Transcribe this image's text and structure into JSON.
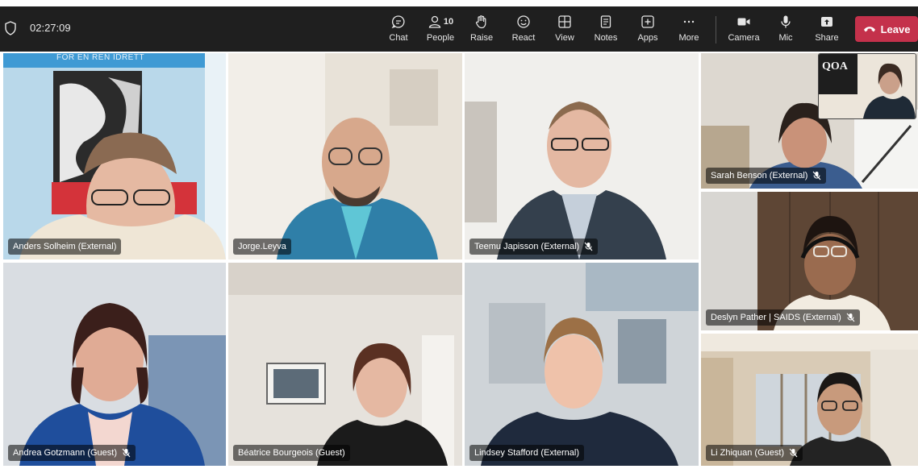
{
  "meeting": {
    "duration": "02:27:09"
  },
  "toolbar": {
    "chat": "Chat",
    "people": "People",
    "people_count": "10",
    "raise": "Raise",
    "react": "React",
    "view": "View",
    "notes": "Notes",
    "apps": "Apps",
    "more": "More",
    "camera": "Camera",
    "mic": "Mic",
    "share": "Share",
    "leave": "Leave"
  },
  "participants": [
    {
      "name": "Anders Solheim (External)",
      "muted": false
    },
    {
      "name": "Jorge.Leyva",
      "muted": false
    },
    {
      "name": "Teemu Japisson (External)",
      "muted": true
    },
    {
      "name": "Sarah Benson (External)",
      "muted": true
    },
    {
      "name": "Deslyn Pather | SAIDS (External)",
      "muted": true
    },
    {
      "name": "Andrea Gotzmann (Guest)",
      "muted": true
    },
    {
      "name": "Béatrice Bourgeois (Guest)",
      "muted": false
    },
    {
      "name": "Lindsey Stafford (External)",
      "muted": false
    },
    {
      "name": "Li Zhiquan (Guest)",
      "muted": true
    }
  ],
  "backgrounds": {
    "banner_text": "FOR EN REN IDRETT",
    "self_view_logo": "QOA"
  },
  "colors": {
    "topbar": "#1f1f1f",
    "leave": "#c4314b"
  }
}
